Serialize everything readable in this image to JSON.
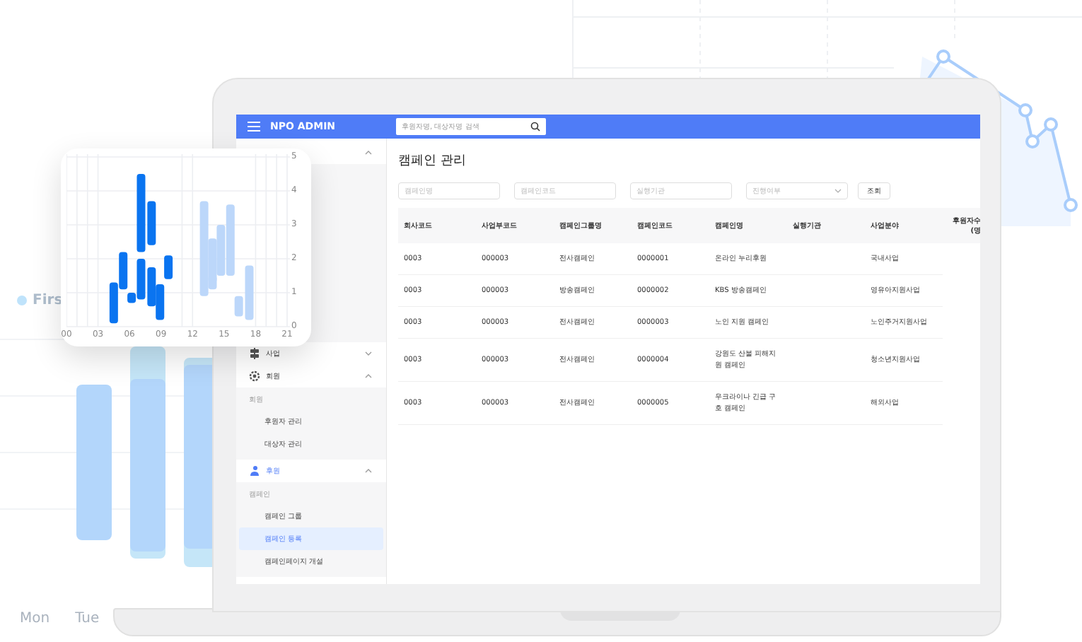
{
  "background": {
    "legend": "Firs",
    "day_labels": [
      "Mon",
      "Tue"
    ]
  },
  "header": {
    "title": "NPO ADMIN",
    "search": {
      "placeholder": "후원자명, 대상자명 검색"
    }
  },
  "sidebar": {
    "menus": [
      {
        "kind": "plain",
        "expanded": true
      },
      {
        "kind": "business",
        "label": "사업",
        "expanded": false,
        "active": false
      },
      {
        "kind": "member",
        "label": "회원",
        "expanded": true,
        "active": false,
        "section": "회원",
        "items": [
          {
            "label": "후원자 관리",
            "selected": false
          },
          {
            "label": "대상자 관리",
            "selected": false
          }
        ]
      },
      {
        "kind": "support",
        "label": "후원",
        "expanded": true,
        "active": true,
        "section": "캠페인",
        "items": [
          {
            "label": "캠페인 그룹",
            "selected": false
          },
          {
            "label": "캠페인 등록",
            "selected": true
          },
          {
            "label": "캠페인페이지 개설",
            "selected": false
          }
        ]
      }
    ]
  },
  "page": {
    "title": "캠페인 관리",
    "filters": [
      {
        "kind": "text",
        "placeholder": "캠페인명"
      },
      {
        "kind": "text",
        "placeholder": "캠페인코드"
      },
      {
        "kind": "text",
        "placeholder": "실행기관"
      },
      {
        "kind": "select",
        "placeholder": "진행여부"
      }
    ],
    "search_button": "조회",
    "table": {
      "columns": [
        "회사코드",
        "사업부코드",
        "캠페인그룹명",
        "캠페인코드",
        "캠페인명",
        "실행기관",
        "사업분야",
        "후원자수(명"
      ],
      "rows": [
        [
          "0003",
          "000003",
          "전사캠페인",
          "0000001",
          "온라인 누리후원",
          "",
          "국내사업"
        ],
        [
          "0003",
          "000003",
          "방송캠페인",
          "0000002",
          "KBS 방송캠페인",
          "",
          "영유아지원사업"
        ],
        [
          "0003",
          "000003",
          "전사캠페인",
          "0000003",
          "노인 지원 캠페인",
          "",
          "노인주거지원사업"
        ],
        [
          "0003",
          "000003",
          "전사캠페인",
          "0000004",
          "강원도 산불 피해지원 캠페인",
          "",
          "청소년지원사업"
        ],
        [
          "0003",
          "000003",
          "전사캠페인",
          "0000005",
          "우크라이나 긴급 구호 캠페인",
          "",
          "해외사업"
        ]
      ]
    }
  },
  "chart_card": {
    "chart_data": {
      "type": "candlestick",
      "xlim": [
        0,
        21
      ],
      "ylim": [
        0,
        5
      ],
      "grid": true,
      "xticks": [
        {
          "value": 0,
          "label": "00"
        },
        {
          "value": 3,
          "label": "03"
        },
        {
          "value": 6,
          "label": "06"
        },
        {
          "value": 9,
          "label": "09"
        },
        {
          "value": 12,
          "label": "12"
        },
        {
          "value": 15,
          "label": "15"
        },
        {
          "value": 18,
          "label": "18"
        },
        {
          "value": 21,
          "label": "21"
        }
      ],
      "yticks": [
        5,
        4,
        3,
        2,
        1,
        0
      ],
      "x": [
        4.5,
        5.4,
        6.2,
        7.1,
        7.1,
        8.1,
        8.1,
        8.9,
        9.7,
        13.1,
        13.9,
        13.9,
        14.7,
        15.6,
        16.4,
        17.4
      ],
      "series": [
        {
          "color": "#0a74f0",
          "ohlc": [
            [
              0.1,
              1.3,
              0.1,
              1.3
            ],
            [
              1.1,
              2.2,
              1.1,
              2.2
            ],
            [
              0.7,
              1.0,
              0.7,
              1.0
            ],
            [
              2.2,
              4.5,
              2.2,
              4.5
            ],
            [
              0.8,
              2.0,
              0.8,
              2.0
            ],
            [
              2.4,
              3.7,
              2.4,
              3.7
            ],
            [
              0.6,
              1.75,
              0.6,
              1.75
            ],
            [
              0.2,
              1.25,
              0.2,
              1.25
            ],
            [
              1.4,
              2.1,
              1.4,
              2.1
            ],
            null,
            null,
            null,
            null,
            null,
            null,
            null
          ]
        },
        {
          "color": "#bcd7fa",
          "ohlc": [
            null,
            null,
            null,
            null,
            null,
            null,
            null,
            null,
            null,
            [
              0.9,
              3.7,
              0.9,
              3.7
            ],
            [
              1.3,
              2.6,
              1.3,
              2.6
            ],
            [
              1.1,
              1.5,
              1.1,
              1.5
            ],
            [
              1.5,
              3.0,
              1.5,
              3.0
            ],
            [
              1.5,
              3.6,
              1.5,
              3.6
            ],
            [
              0.3,
              0.9,
              0.3,
              0.9
            ],
            [
              0.2,
              1.8,
              0.2,
              1.8
            ]
          ]
        }
      ]
    }
  }
}
